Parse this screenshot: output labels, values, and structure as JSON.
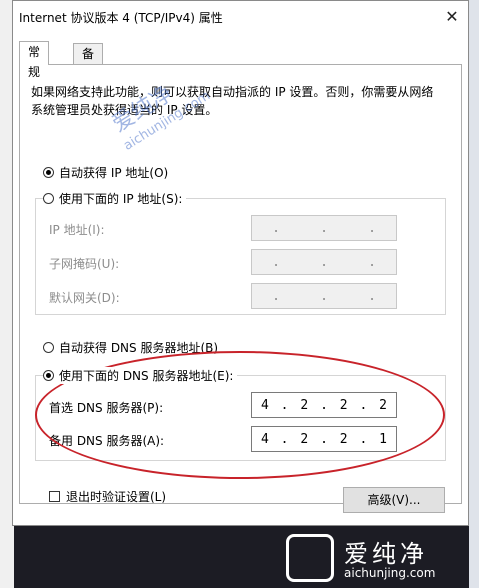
{
  "window": {
    "title": "Internet 协议版本 4 (TCP/IPv4) 属性",
    "close_glyph": "✕"
  },
  "tabs": [
    {
      "label": "常规"
    },
    {
      "label": "备用配置"
    }
  ],
  "description": "如果网络支持此功能，则可以获取自动指派的 IP 设置。否则，你需要从网络系统管理员处获得适当的 IP 设置。",
  "ip": {
    "auto_label": "自动获得 IP 地址(O)",
    "manual_label": "使用下面的 IP 地址(S):",
    "fields": [
      {
        "label": "IP 地址(I):",
        "octets": [
          ".",
          ".",
          "."
        ]
      },
      {
        "label": "子网掩码(U):",
        "octets": [
          ".",
          ".",
          "."
        ]
      },
      {
        "label": "默认网关(D):",
        "octets": [
          ".",
          ".",
          "."
        ]
      }
    ]
  },
  "dns": {
    "auto_label": "自动获得 DNS 服务器地址(B)",
    "manual_label": "使用下面的 DNS 服务器地址(E):",
    "preferred": {
      "label": "首选 DNS 服务器(P):",
      "octets": [
        "4",
        "2",
        "2",
        "2"
      ]
    },
    "alternate": {
      "label": "备用 DNS 服务器(A):",
      "octets": [
        "4",
        "2",
        "2",
        "1"
      ]
    }
  },
  "validate_label": "退出时验证设置(L)",
  "advanced_label": "高级(V)...",
  "watermark": {
    "text": "爱纯净",
    "url": "aichunjing.com"
  },
  "logo": {
    "brand": "爱纯净",
    "url": "aichunjing.com"
  },
  "colors": {
    "highlight_oval": "#c8232a"
  }
}
